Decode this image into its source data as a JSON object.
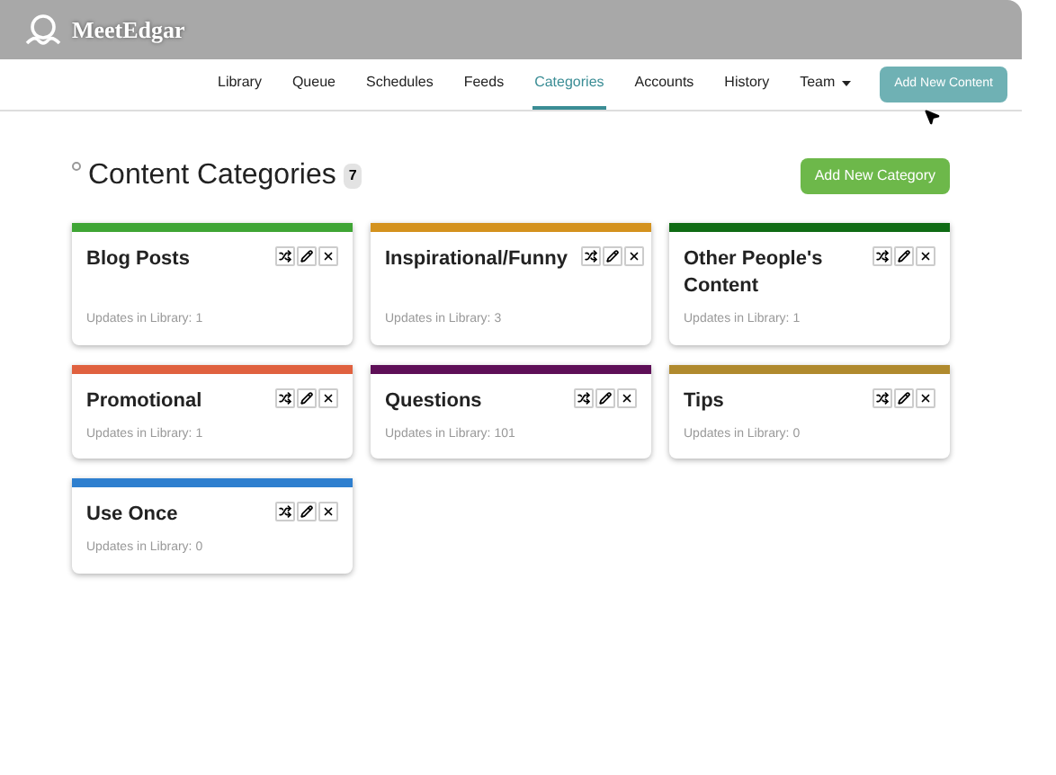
{
  "logo": {
    "text": "MeetEdgar"
  },
  "nav": [
    {
      "label": "Library",
      "selected": false
    },
    {
      "label": "Queue",
      "selected": false
    },
    {
      "label": "Schedules",
      "selected": false
    },
    {
      "label": "Feeds",
      "selected": false
    },
    {
      "label": "Categories",
      "selected": true
    },
    {
      "label": "Accounts",
      "selected": false
    },
    {
      "label": "History",
      "selected": false
    },
    {
      "label": "Team",
      "selected": false,
      "kind": "dropdown"
    }
  ],
  "add_content_button": "Add New Content",
  "page": {
    "title": "Content Categories",
    "count": "7",
    "add_button": "Add New Category"
  },
  "categories": [
    {
      "name": "Blog Posts",
      "updates": "Updates in Library: 1",
      "color": "#3fa535"
    },
    {
      "name": "Inspirational/Funny",
      "updates": "Updates in Library: 3",
      "color": "#d4921e"
    },
    {
      "name": "Other People's Content",
      "updates": "Updates in Library: 1",
      "color": "#0f6b14"
    },
    {
      "name": "Promotional",
      "updates": "Updates in Library: 1",
      "color": "#e0613f"
    },
    {
      "name": "Questions",
      "updates": "Updates in Library: 101",
      "color": "#5e0f57"
    },
    {
      "name": "Tips",
      "updates": "Updates in Library: 0",
      "color": "#b08a2e"
    },
    {
      "name": "Use Once",
      "updates": "Updates in Library: 0",
      "color": "#2e7fcf"
    }
  ]
}
